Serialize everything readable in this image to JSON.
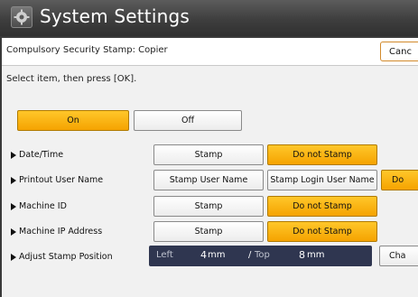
{
  "window": {
    "title": "System Settings",
    "icon": "settings-icon"
  },
  "header": {
    "title": "Compulsory Security Stamp: Copier",
    "cancel_label": "Canc"
  },
  "instruction": "Select item, then press [OK].",
  "toggle": {
    "on_label": "On",
    "off_label": "Off",
    "selected": "On"
  },
  "rows": [
    {
      "label": "Date/Time",
      "option1": "Stamp",
      "option2": "Do not Stamp",
      "selected": "Do not Stamp"
    },
    {
      "label": "Printout User Name",
      "option1": "Stamp User Name",
      "option2": "Stamp Login User Name",
      "option3": "Do",
      "selected": "Do"
    },
    {
      "label": "Machine ID",
      "option1": "Stamp",
      "option2": "Do not Stamp",
      "selected": "Do not Stamp"
    },
    {
      "label": "Machine IP Address",
      "option1": "Stamp",
      "option2": "Do not Stamp",
      "selected": "Do not Stamp"
    }
  ],
  "adjust": {
    "label": "Adjust Stamp Position",
    "left_label": "Left",
    "left_value": "4",
    "left_unit": "mm",
    "separator": "/",
    "top_label": "Top",
    "top_value": "8",
    "top_unit": "mm",
    "change_label": "Cha"
  },
  "colors": {
    "selected": "#f5a300",
    "title_bar": "#3e3e3e",
    "position_box": "#2f3650"
  }
}
